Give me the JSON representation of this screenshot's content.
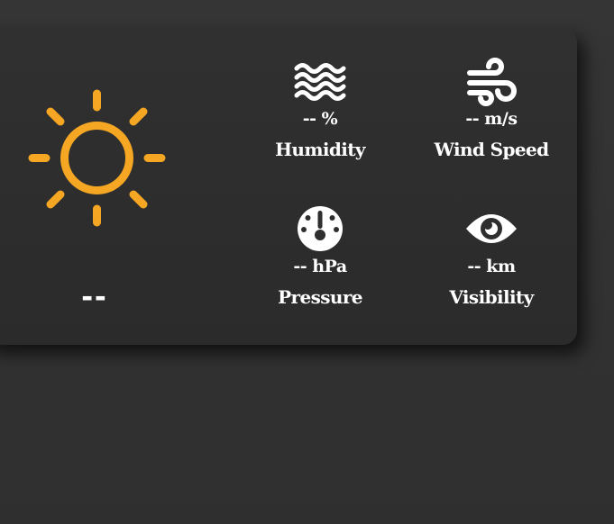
{
  "weather": {
    "temperature": "--",
    "condition_icon": "sun-icon",
    "accent_color": "#f5a623",
    "metrics": [
      {
        "icon": "waves-icon",
        "value": "-- %",
        "label": "Humidity"
      },
      {
        "icon": "wind-icon",
        "value": "-- m/s",
        "label": "Wind Speed"
      },
      {
        "icon": "gauge-icon",
        "value": "-- hPa",
        "label": "Pressure"
      },
      {
        "icon": "eye-icon",
        "value": "-- km",
        "label": "Visibility"
      }
    ]
  }
}
